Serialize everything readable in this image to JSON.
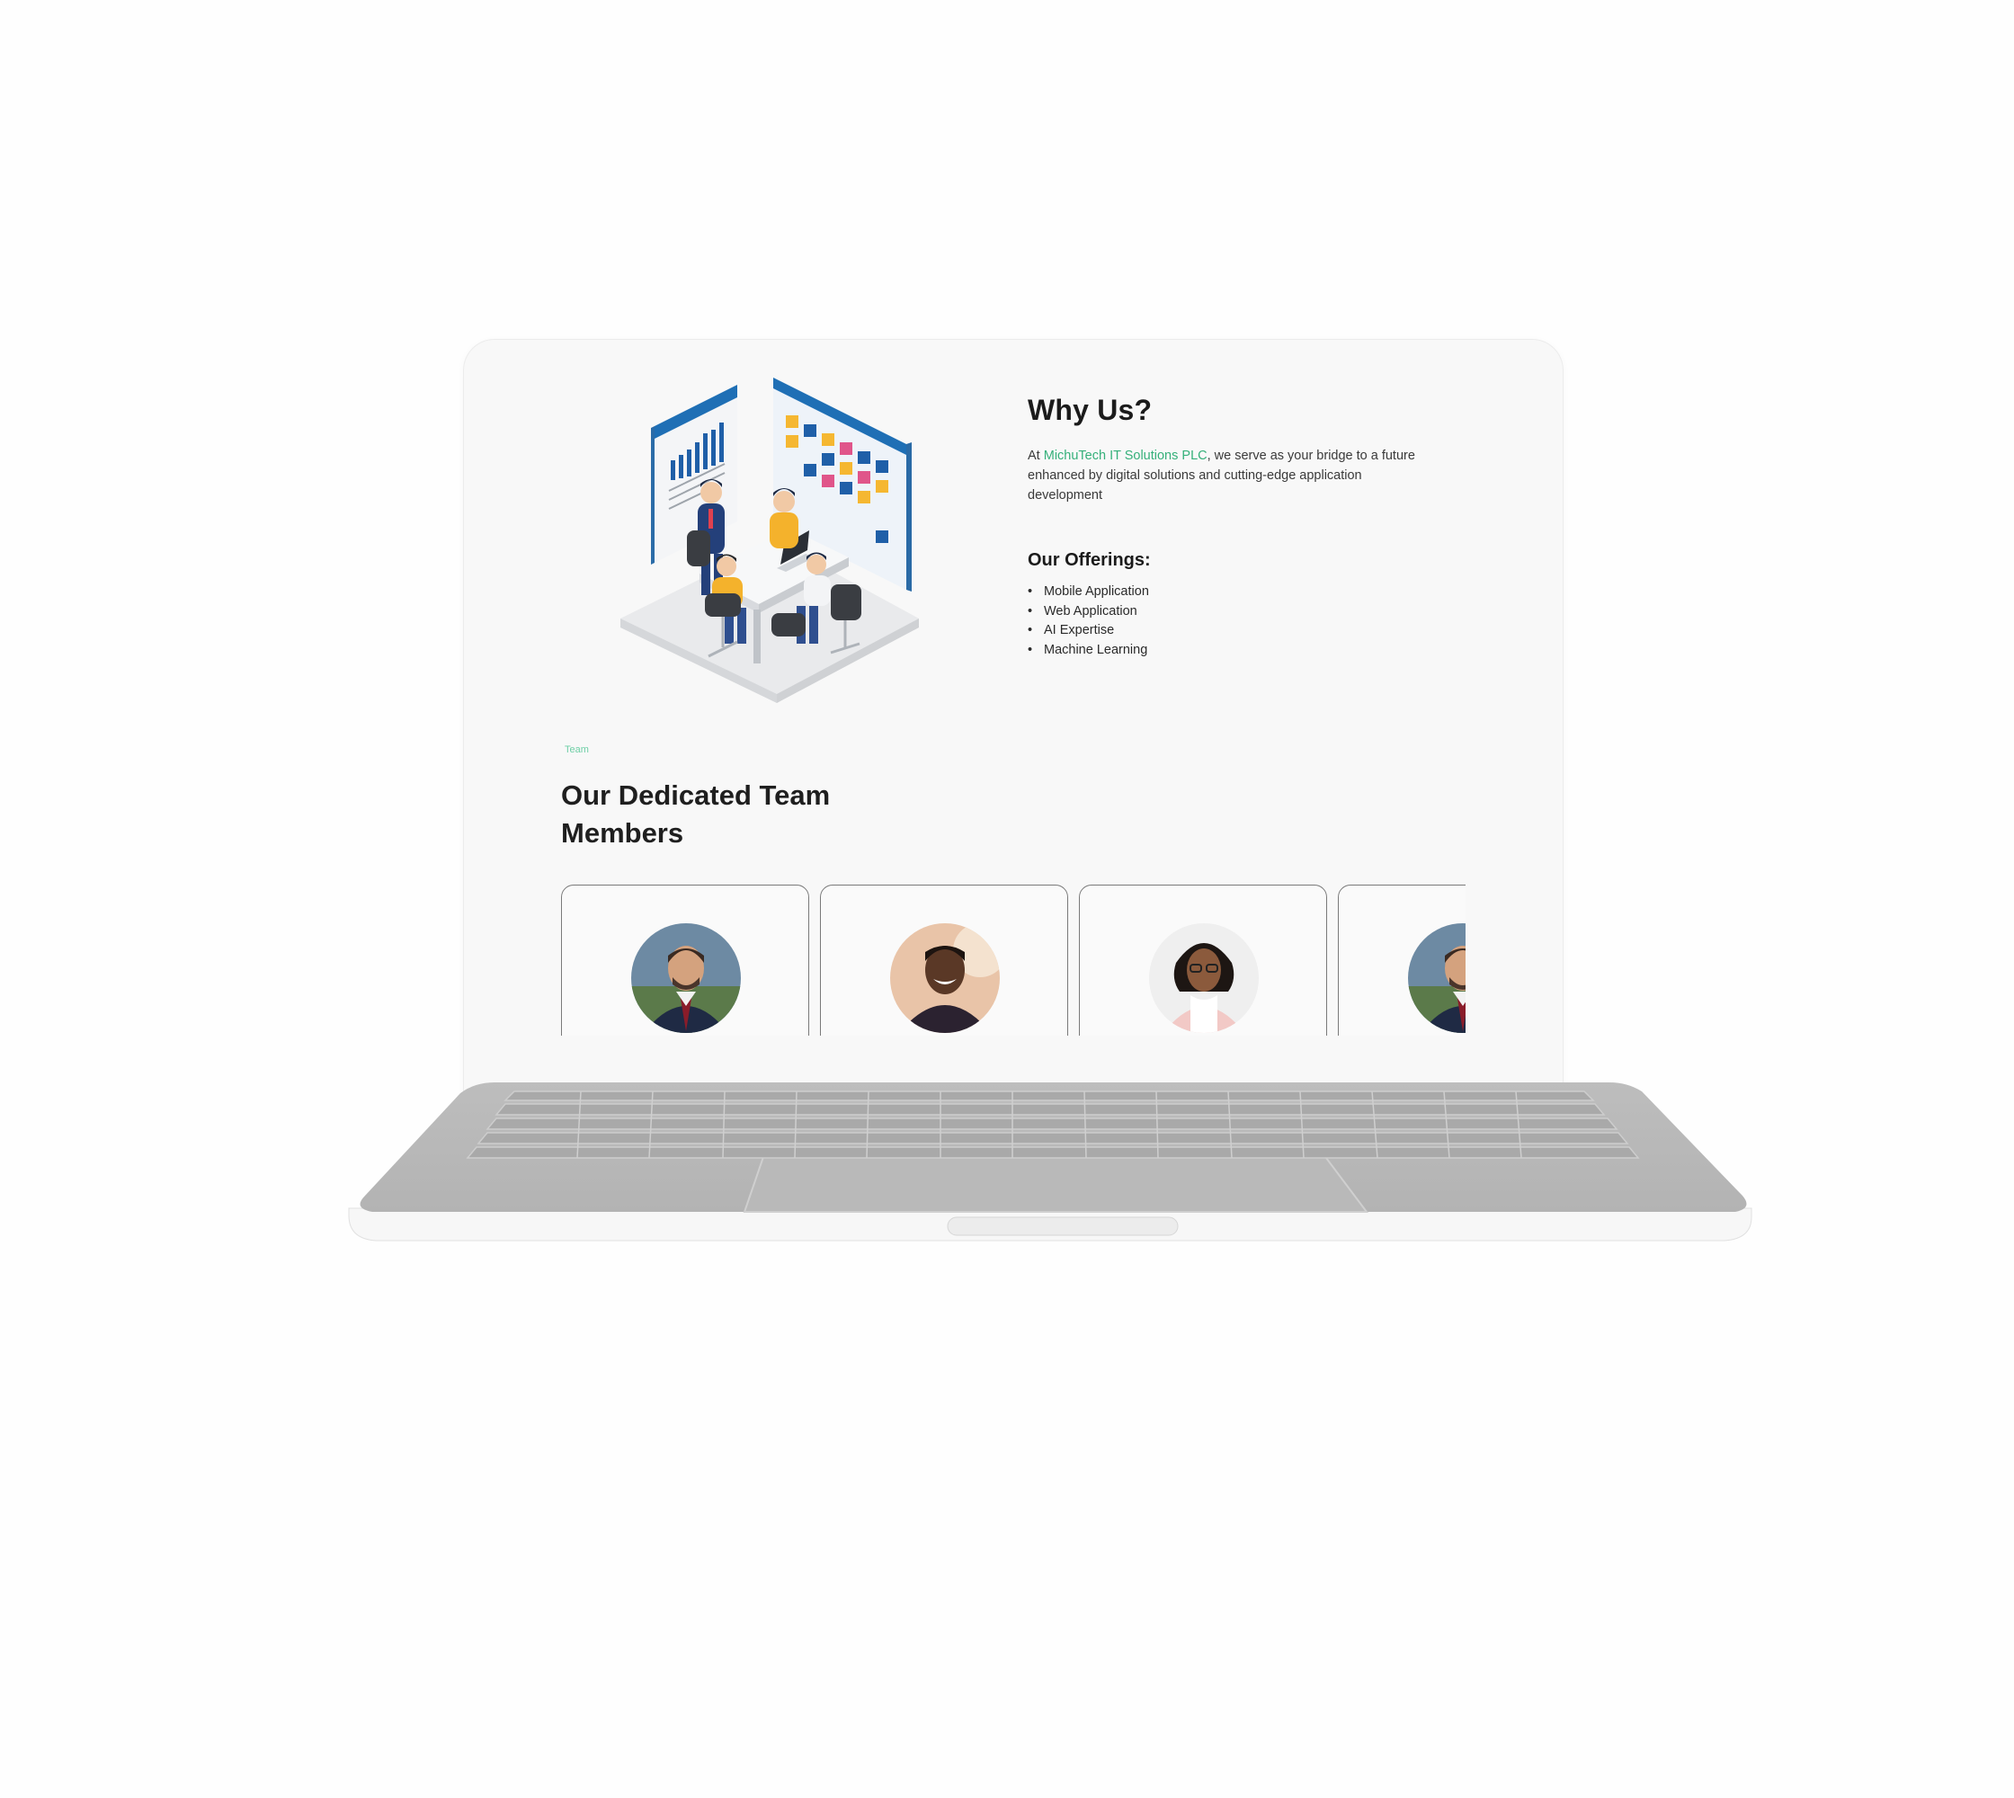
{
  "why_us": {
    "title": "Why Us?",
    "body_prefix": "At ",
    "brand": "MichuTech IT Solutions PLC",
    "body_suffix": ", we serve as your bridge to a future enhanced by digital solutions and cutting-edge application development"
  },
  "offerings": {
    "title": "Our Offerings:",
    "items": [
      "Mobile Application",
      "Web Application",
      "AI Expertise",
      "Machine Learning"
    ]
  },
  "team": {
    "label": "Team",
    "title": "Our Dedicated Team Members"
  },
  "colors": {
    "brand_green": "#35b07a",
    "heading": "#1b1b1b"
  }
}
